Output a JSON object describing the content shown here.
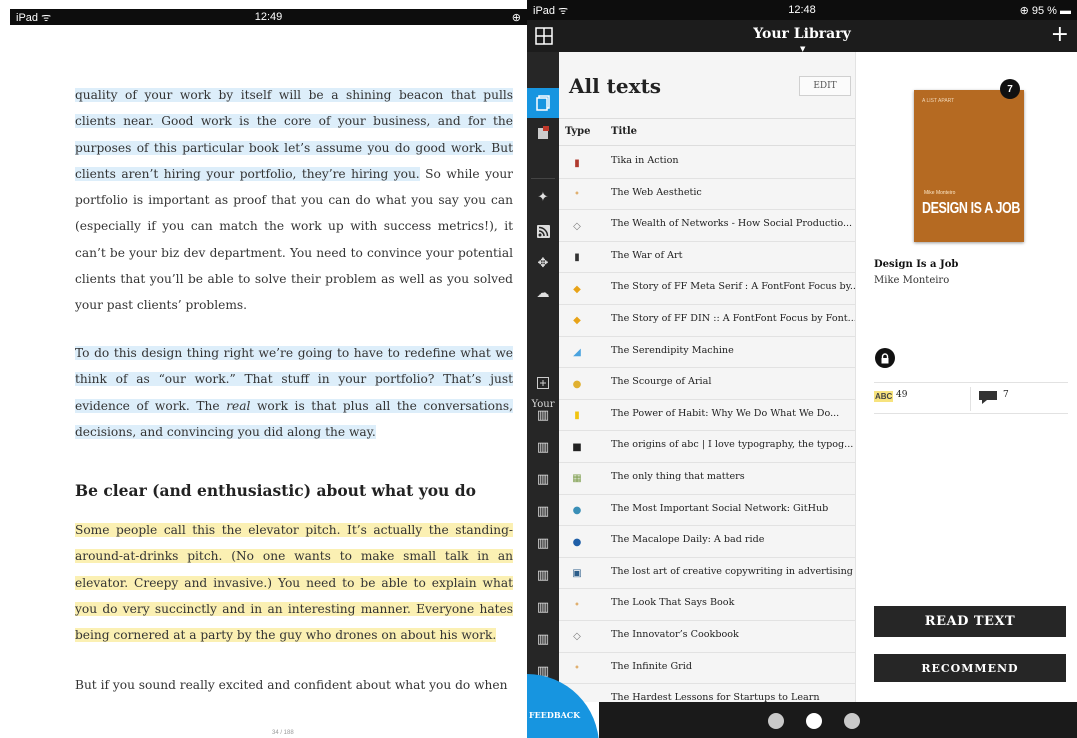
{
  "reader": {
    "status": {
      "device": "iPad ᯤ",
      "time": "12:49",
      "right": "⊕"
    },
    "paragraph1": {
      "hl": "quality of your work by itself will be a shining beacon that pulls clients near. Good work is the core of your business, and for the purposes of this particular book let’s assume you do good work. But clients aren’t hiring your portfolio, they’re hiring you.",
      "rest": " So while your portfolio is important as proof that you can do what you say you can (especially if you can match the work up with success metrics!), it can’t be your biz dev department. You need to convince your potential clients that you’ll be able to solve their problem as well as you solved your past clients’ problems."
    },
    "paragraph2": {
      "before_em": "To do this design thing right we’re going to have to redefine what we think of as “our work.” That stuff in your portfolio? That’s just evidence of work. The ",
      "em": "real",
      "after_em": " work is that plus all the conversations, decisions, and convincing you did along the way."
    },
    "heading": "Be clear (and enthusiastic) about what you do",
    "paragraph3": "Some people call this the elevator pitch. It’s actually the standing-around-at-drinks pitch. (No one wants to make small talk in an elevator. Creepy and invasive.) You need to be able to explain what you do very succinctly and in an interesting manner. Everyone hates being cornered at a party by the guy who drones on about his work.",
    "paragraph4": "But if you sound really excited and confident about what you do when",
    "page_indicator": "34 / 188"
  },
  "library": {
    "status": {
      "device": "iPad ᯤ",
      "time": "12:48",
      "battery": "⊕ 95 % ▬"
    },
    "title": "Your Library",
    "add_label": "+",
    "sidebar_your_label": "Your",
    "list": {
      "heading": "All texts",
      "edit_label": "EDIT",
      "col_type": "Type",
      "col_title": "Title",
      "rows": [
        {
          "title": "Tika in Action",
          "thumb": "▮",
          "color": "#b03a2e"
        },
        {
          "title": "The Web Aesthetic",
          "thumb": "•",
          "color": "#e0b070"
        },
        {
          "title": "The Wealth of Networks - How Social Productio...",
          "thumb": "◇",
          "color": "#777777"
        },
        {
          "title": "The War of Art",
          "thumb": "▮",
          "color": "#333333"
        },
        {
          "title": "The Story of FF Meta Serif : A FontFont Focus by...",
          "thumb": "◆",
          "color": "#e8a317"
        },
        {
          "title": "The Story of FF DIN :: A FontFont Focus by Font...",
          "thumb": "◆",
          "color": "#e8a317"
        },
        {
          "title": "The Serendipity Machine",
          "thumb": "◢",
          "color": "#4aa3df"
        },
        {
          "title": "The Scourge of Arial",
          "thumb": "●",
          "color": "#e0b030"
        },
        {
          "title": "The Power of Habit: Why We Do What We Do...",
          "thumb": "▮",
          "color": "#f1c40f"
        },
        {
          "title": "The origins of abc | I love typography, the typog...",
          "thumb": "■",
          "color": "#222222"
        },
        {
          "title": "The only thing that matters",
          "thumb": "▦",
          "color": "#7f9f4f"
        },
        {
          "title": "The Most Important Social Network: GitHub",
          "thumb": "●",
          "color": "#3a8fb7"
        },
        {
          "title": "The Macalope Daily: A bad ride",
          "thumb": "●",
          "color": "#1f5fa8"
        },
        {
          "title": "The lost art of creative copywriting in advertising",
          "thumb": "▣",
          "color": "#2c5d8a"
        },
        {
          "title": "The Look That Says Book",
          "thumb": "•",
          "color": "#e0b070"
        },
        {
          "title": "The Innovator’s Cookbook",
          "thumb": "◇",
          "color": "#777777"
        },
        {
          "title": "The Infinite Grid",
          "thumb": "•",
          "color": "#e0b070"
        },
        {
          "title": "The Hardest Lessons for Startups to Learn",
          "thumb": "•",
          "color": "#e0b070"
        }
      ]
    },
    "feedback_label": "FEEDBACK",
    "detail": {
      "cover_top": "A LIST APART",
      "cover_author": "Mike Monteiro",
      "cover_title": "DESIGN IS A JOB",
      "badge_count": "7",
      "book_title": "Design Is a Job",
      "book_author": "Mike Monteiro",
      "highlights_icon": "ABC",
      "highlights": "49",
      "comments": "7",
      "read_label": "READ TEXT",
      "recommend_label": "RECOMMEND"
    },
    "pages": {
      "count": 3,
      "active_index": 1
    }
  },
  "colors": {
    "accent": "#1795e0",
    "dark_bar": "#1c1c1c",
    "highlight_blue": "#ddeefa",
    "highlight_yellow": "#fbf0b3",
    "cover": "#b56a22"
  }
}
